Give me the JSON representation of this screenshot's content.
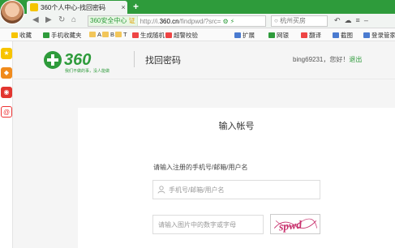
{
  "browser": {
    "tab_title": "360个人中心-找回密码",
    "tab_close": "×",
    "new_tab": "+",
    "security_label": "360安全中心",
    "security_badge": "证",
    "url_prefix": "http://i.",
    "url_domain": "360.cn",
    "url_path": "/findpwd/?src=",
    "search_text": "杭州买房"
  },
  "bookmarks": [
    {
      "label": "收藏",
      "icon": "star-icon"
    },
    {
      "label": "手机收藏夹",
      "icon": "phone-icon"
    },
    {
      "label": "A",
      "icon": "folder-icon"
    },
    {
      "label": "B",
      "icon": "folder-icon"
    },
    {
      "label": "T",
      "icon": "folder-icon"
    },
    {
      "label": "生成随机",
      "icon": "page-icon"
    },
    {
      "label": "超警校验",
      "icon": "page-icon"
    },
    {
      "label": "扩展",
      "icon": "extension-icon"
    },
    {
      "label": "网银",
      "icon": "bank-icon"
    },
    {
      "label": "翻译",
      "icon": "translate-icon"
    },
    {
      "label": "截图",
      "icon": "screenshot-icon"
    },
    {
      "label": "登录管家",
      "icon": "login-icon"
    }
  ],
  "header": {
    "page_title": "找回密码",
    "username": "bing69231",
    "greeting": "，您好！",
    "logout": "退出",
    "logo_text": "360",
    "logo_slogan": "我们不做的事，没人能做"
  },
  "form": {
    "title": "输入帐号",
    "prompt": "请输入注册的手机号/邮箱/用户名",
    "account_placeholder": "手机号/邮箱/用户名",
    "captcha_placeholder": "请输入图片中的数字或字母",
    "captcha_text": "spwd"
  },
  "colors": {
    "brand_green": "#2e9b3b",
    "link_green": "#2e9b3b"
  }
}
